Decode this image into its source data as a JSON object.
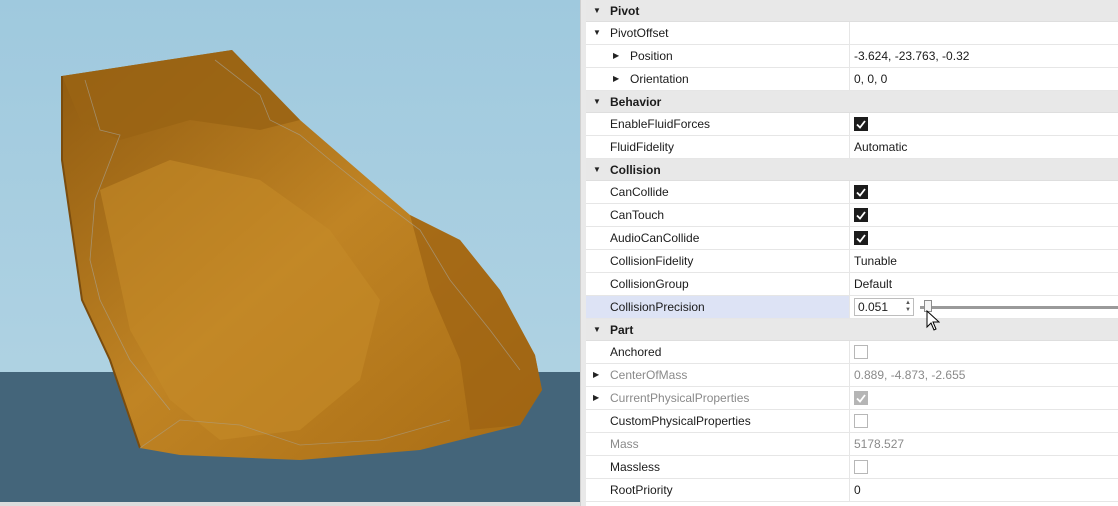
{
  "properties": {
    "pivot": {
      "header": "Pivot",
      "pivot_offset": {
        "label": "PivotOffset",
        "value": ""
      },
      "position": {
        "label": "Position",
        "value": "-3.624, -23.763, -0.32"
      },
      "orientation": {
        "label": "Orientation",
        "value": "0, 0, 0"
      }
    },
    "behavior": {
      "header": "Behavior",
      "enable_fluid_forces": {
        "label": "EnableFluidForces",
        "checked": true
      },
      "fluid_fidelity": {
        "label": "FluidFidelity",
        "value": "Automatic"
      }
    },
    "collision": {
      "header": "Collision",
      "can_collide": {
        "label": "CanCollide",
        "checked": true
      },
      "can_touch": {
        "label": "CanTouch",
        "checked": true
      },
      "audio_can_collide": {
        "label": "AudioCanCollide",
        "checked": true
      },
      "collision_fidelity": {
        "label": "CollisionFidelity",
        "value": "Tunable"
      },
      "collision_group": {
        "label": "CollisionGroup",
        "value": "Default"
      },
      "collision_precision": {
        "label": "CollisionPrecision",
        "value": "0.051",
        "slider_fraction": 0.02
      }
    },
    "part": {
      "header": "Part",
      "anchored": {
        "label": "Anchored",
        "checked": false
      },
      "center_of_mass": {
        "label": "CenterOfMass",
        "value": "0.889, -4.873, -2.655"
      },
      "current_physical_properties": {
        "label": "CurrentPhysicalProperties",
        "checked": true
      },
      "custom_physical_properties": {
        "label": "CustomPhysicalProperties",
        "checked": false
      },
      "mass": {
        "label": "Mass",
        "value": "5178.527"
      },
      "massless": {
        "label": "Massless",
        "checked": false
      },
      "root_priority": {
        "label": "RootPriority",
        "value": "0"
      }
    }
  },
  "icons": {
    "expanded": "triangle-down-icon",
    "collapsed": "triangle-right-icon",
    "checkmark": "checkmark-icon"
  },
  "colors": {
    "sky": "#a9cfe1",
    "water": "#44657a",
    "rock": "#b87a1c",
    "section_bg": "#e8e8e8",
    "selected_row": "#dde3f5"
  }
}
